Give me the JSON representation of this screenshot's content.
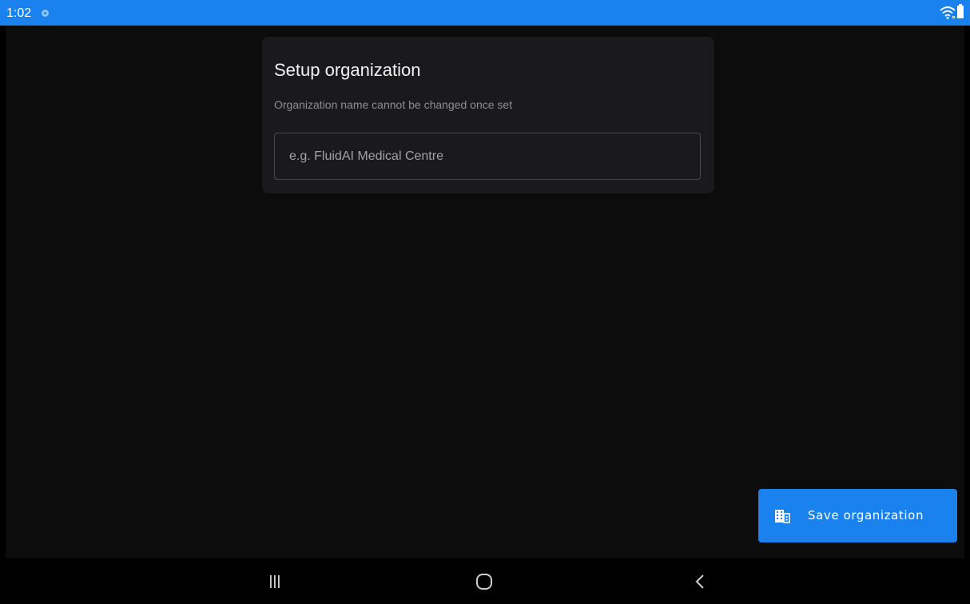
{
  "status_bar": {
    "time": "1:02",
    "background": "#1a82ee",
    "icons": [
      "sync-icon",
      "wifi-icon",
      "battery-icon"
    ]
  },
  "card": {
    "title": "Setup organization",
    "subtitle": "Organization name cannot be changed once set",
    "input": {
      "value": "",
      "placeholder": "e.g. FluidAI Medical Centre"
    }
  },
  "save_button": {
    "label": "Save organization",
    "icon": "building-icon",
    "color": "#1a82ee"
  },
  "nav_bar": {
    "buttons": [
      "recent-apps-icon",
      "home-icon",
      "back-icon"
    ]
  }
}
